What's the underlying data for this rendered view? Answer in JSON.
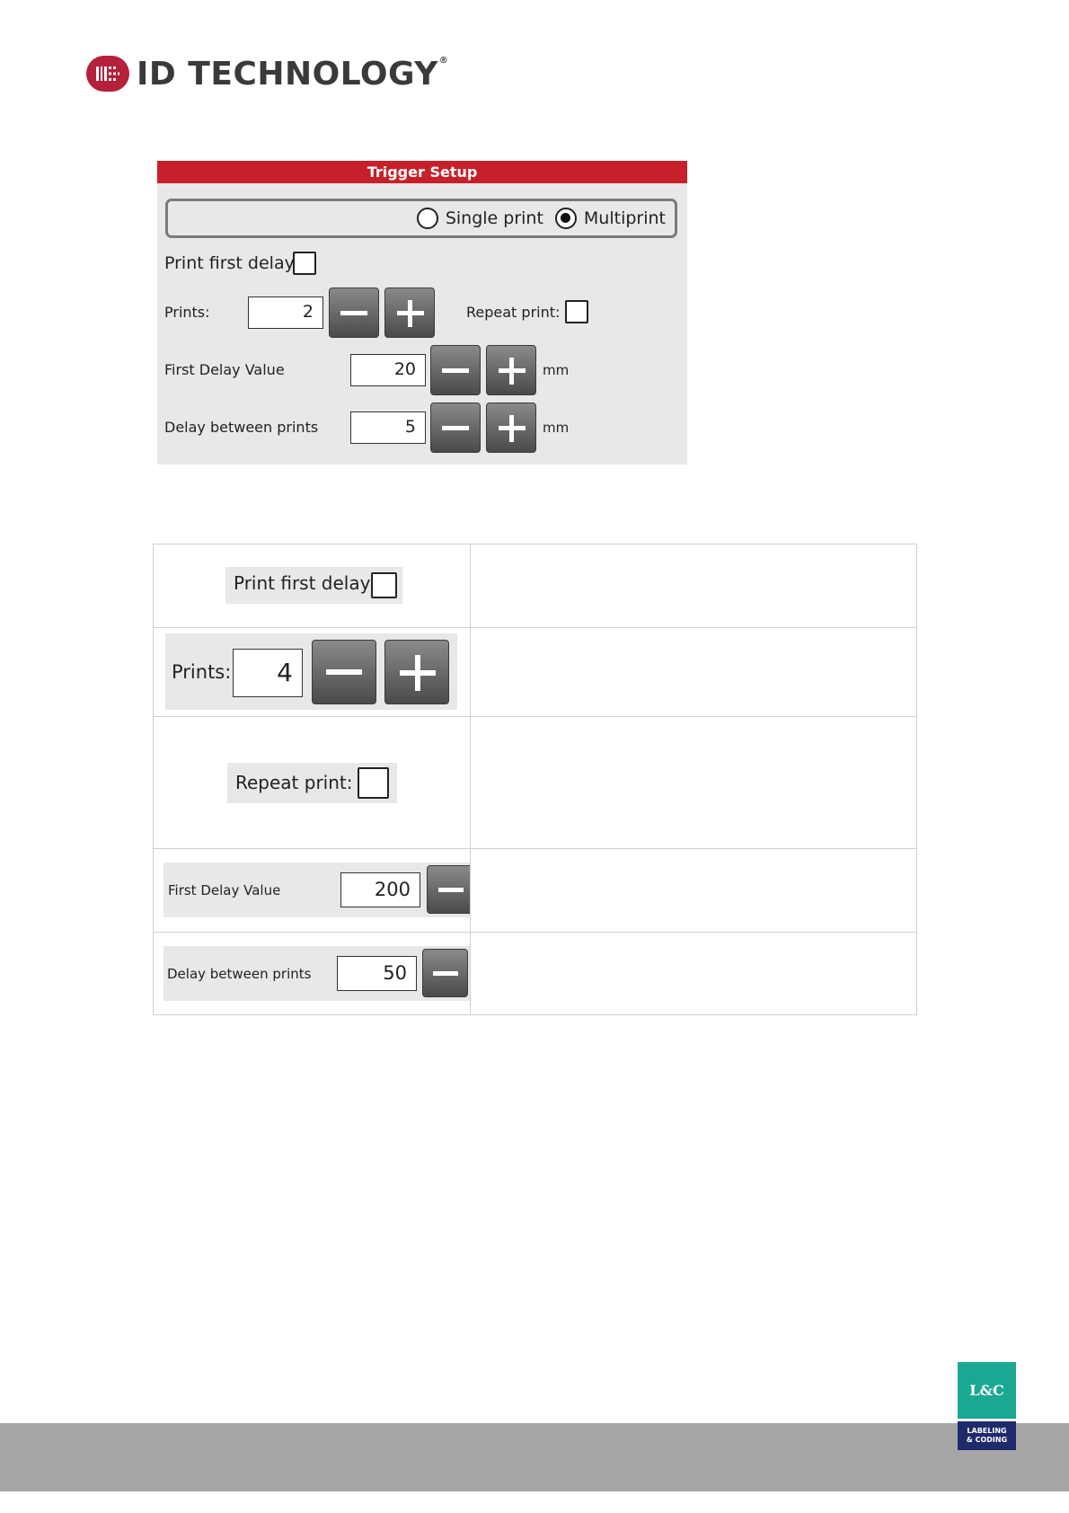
{
  "header": {
    "logo_text": "ID TECHNOLOGY",
    "logo_reg": "®",
    "logo_color": "#b5203a"
  },
  "trigger_panel": {
    "title": "Trigger Setup",
    "title_color": "#c8202a",
    "modes": [
      {
        "label": "Single print",
        "selected": false
      },
      {
        "label": "Multiprint",
        "selected": true
      }
    ],
    "print_first_delay_label": "Print first delay",
    "prints_label": "Prints:",
    "prints_value": "2",
    "repeat_print_label": "Repeat print:",
    "first_delay_label": "First Delay Value",
    "first_delay_value": "20",
    "delay_between_label": "Delay between prints",
    "delay_between_value": "5",
    "unit": "mm"
  },
  "table": {
    "rows": [
      {
        "control": "Print first delay",
        "description": ""
      },
      {
        "control": "Prints:",
        "value": "4",
        "description": ""
      },
      {
        "control": "Repeat print:",
        "description": ""
      },
      {
        "control": "First Delay Value",
        "value": "200",
        "description": ""
      },
      {
        "control": "Delay between prints",
        "value": "50",
        "description": ""
      }
    ]
  },
  "footer": {
    "badge_top": "L&C",
    "badge_line1": "LABELING",
    "badge_line2": "& CODING",
    "bar_color": "#a6a6a6"
  }
}
